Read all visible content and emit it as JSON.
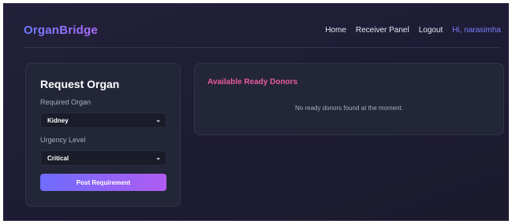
{
  "brand": {
    "name": "OrganBridge"
  },
  "nav": {
    "home": "Home",
    "receiver_panel": "Receiver Panel",
    "logout": "Logout",
    "greeting": "Hi, narasimha"
  },
  "request_form": {
    "title": "Request Organ",
    "organ_label": "Required Organ",
    "organ_value": "Kidney",
    "urgency_label": "Urgency Level",
    "urgency_value": "Critical",
    "submit_label": "Post Requirement"
  },
  "donors": {
    "title": "Available Ready Donors",
    "empty_message": "No ready donors found at the moment."
  },
  "colors": {
    "accent_gradient_start": "#6e6cff",
    "accent_gradient_end": "#b05cf2",
    "donor_title": "#e95aa2",
    "greeting": "#7a7dff"
  }
}
